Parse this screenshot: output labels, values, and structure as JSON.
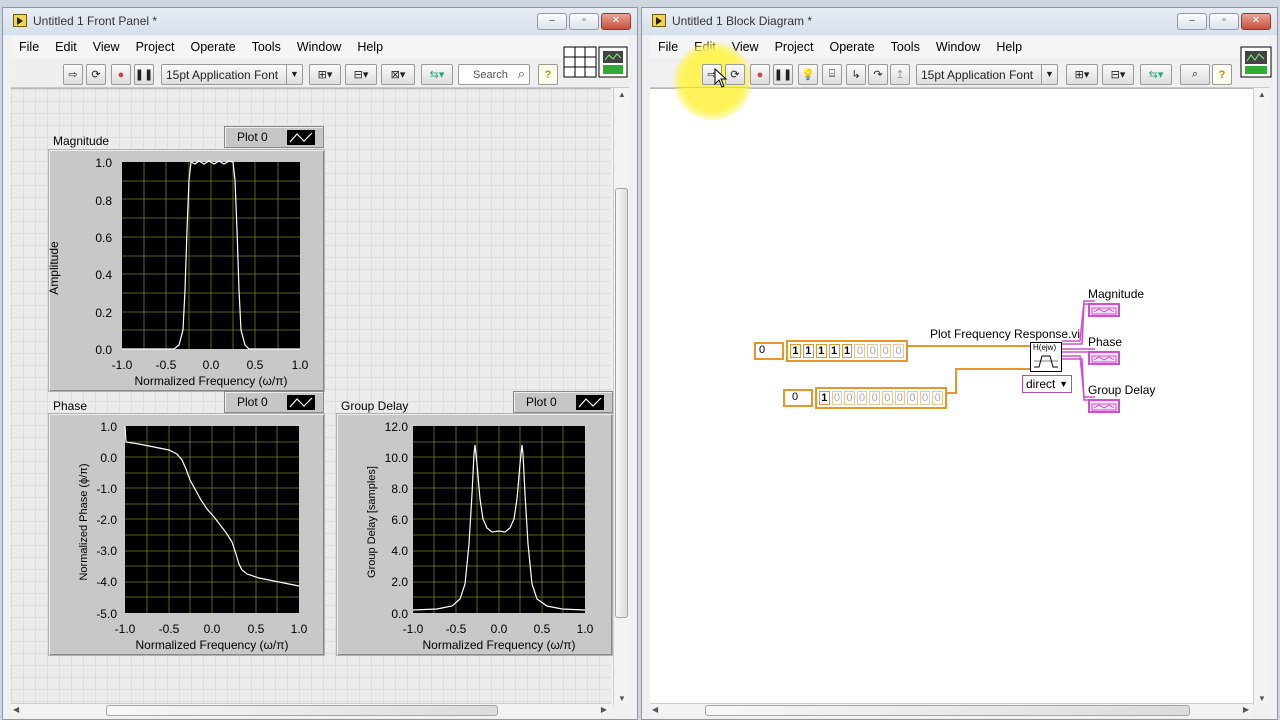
{
  "front_panel": {
    "title": "Untitled 1 Front Panel *",
    "menu": [
      "File",
      "Edit",
      "View",
      "Project",
      "Operate",
      "Tools",
      "Window",
      "Help"
    ],
    "font": "15pt Application Font",
    "search_placeholder": "Search",
    "magnitude": {
      "label": "Magnitude",
      "legend": "Plot 0",
      "ylabel": "Amplitude",
      "xlabel": "Normalized Frequency (ω/π)",
      "yticks": [
        "1.0",
        "0.8",
        "0.6",
        "0.4",
        "0.2",
        "0.0"
      ],
      "xticks": [
        "-1.0",
        "-0.5",
        "0.0",
        "0.5",
        "1.0"
      ]
    },
    "phase": {
      "label": "Phase",
      "legend": "Plot 0",
      "ylabel": "Normalized Phase (ϕ/π)",
      "xlabel": "Normalized Frequency (ω/π)",
      "yticks": [
        "1.0",
        "0.0",
        "-1.0",
        "-2.0",
        "-3.0",
        "-4.0",
        "-5.0"
      ],
      "xticks": [
        "-1.0",
        "-0.5",
        "0.0",
        "0.5",
        "1.0"
      ]
    },
    "group_delay": {
      "label": "Group Delay",
      "legend": "Plot 0",
      "ylabel": "Group Delay [samples]",
      "xlabel": "Normalized Frequency (ω/π)",
      "yticks": [
        "12.0",
        "10.0",
        "8.0",
        "6.0",
        "4.0",
        "2.0",
        "0.0"
      ],
      "xticks": [
        "-1.0",
        "-0.5",
        "0.0",
        "0.5",
        "1.0"
      ]
    }
  },
  "block_diagram": {
    "title": "Untitled 1 Block Diagram *",
    "menu": [
      "File",
      "Edit",
      "View",
      "Project",
      "Operate",
      "Tools",
      "Window",
      "Help"
    ],
    "font": "15pt Application Font",
    "vi_label": "Plot Frequency Response.vi",
    "array1_index": "0",
    "array1_values": [
      "1",
      "1",
      "1",
      "1",
      "1",
      "0",
      "0",
      "0",
      "0"
    ],
    "array2_index": "0",
    "array2_values": [
      "1",
      "0",
      "0",
      "0",
      "0",
      "0",
      "0",
      "0",
      "0",
      "0"
    ],
    "mode": "direct",
    "vi_icon_text": "H(ejw)",
    "outputs": [
      "Magnitude",
      "Phase",
      "Group Delay"
    ]
  },
  "colors": {
    "orange_wire": "#e8962a",
    "pink_wire": "#d04fd0",
    "plot_bg": "#000000",
    "grid": "#8a8a33"
  }
}
